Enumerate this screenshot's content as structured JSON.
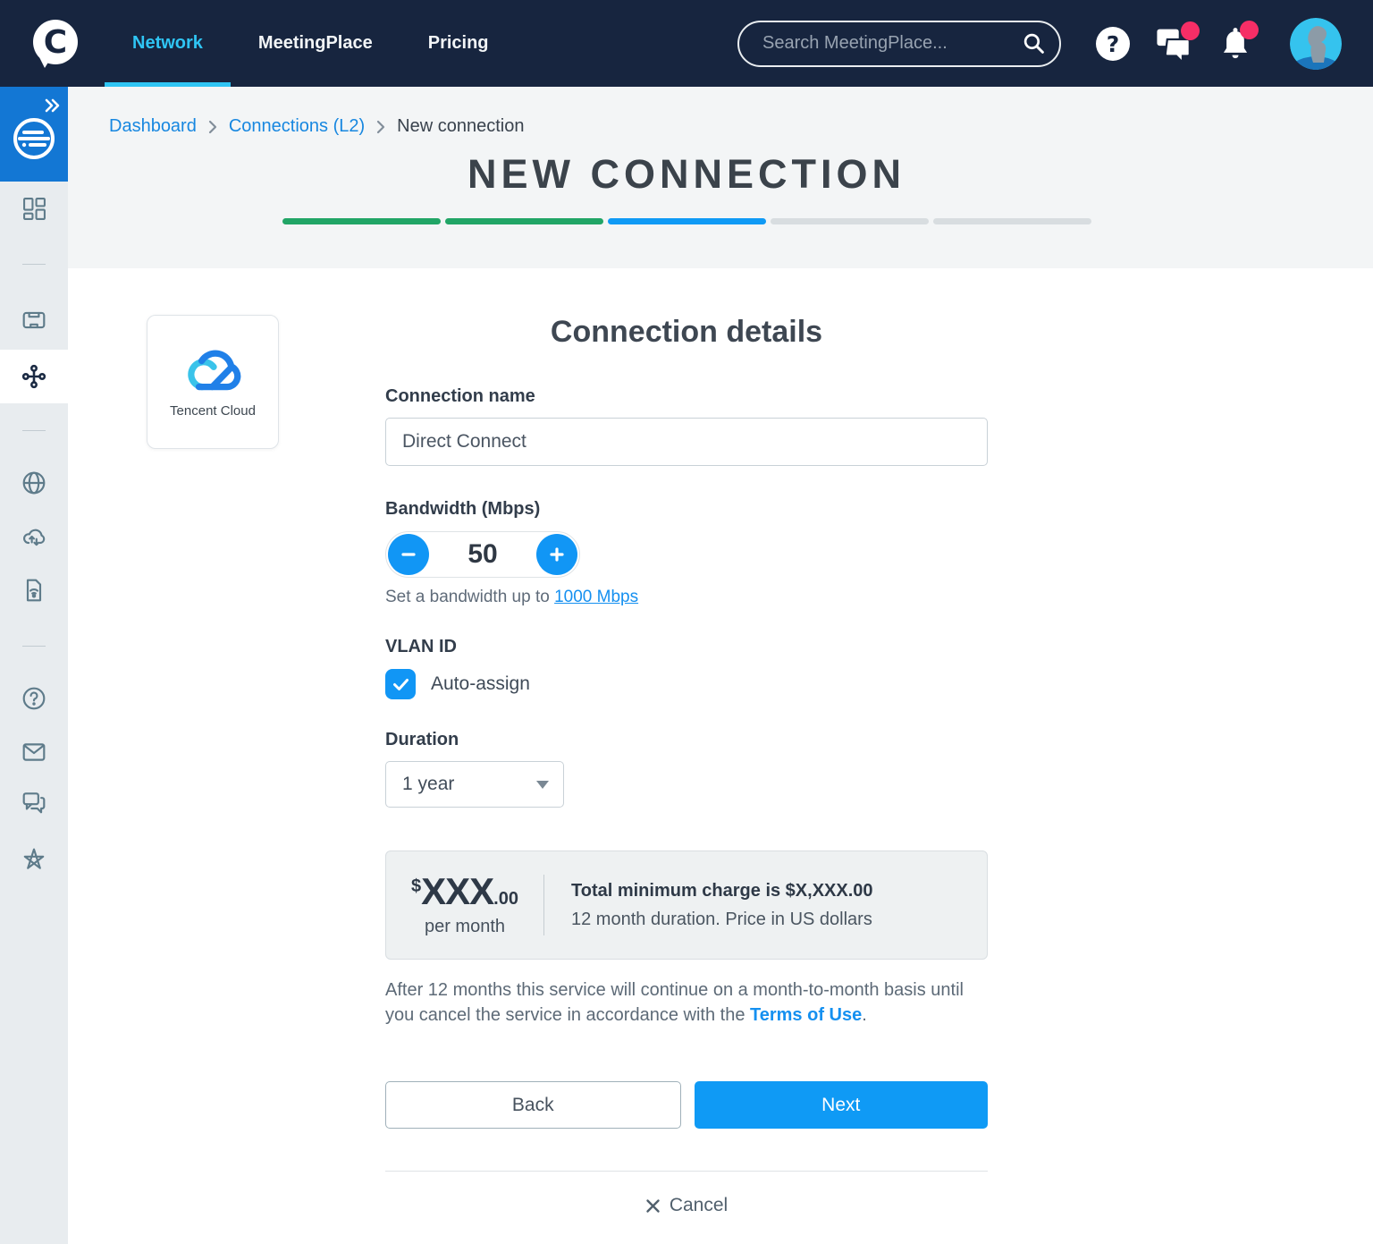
{
  "colors": {
    "navbar_bg": "#17253F",
    "accent_cyan": "#2FC5F4",
    "accent_blue": "#0F9AF5",
    "link_blue": "#1787E0",
    "progress_green": "#21A566",
    "badge_pink": "#F62E66",
    "sidebar_blue": "#1377D4"
  },
  "navbar": {
    "tabs": [
      {
        "label": "Network",
        "active": true
      },
      {
        "label": "MeetingPlace",
        "active": false
      },
      {
        "label": "Pricing",
        "active": false
      }
    ],
    "search": {
      "placeholder": "Search MeetingPlace..."
    }
  },
  "breadcrumb": {
    "links": [
      "Dashboard",
      "Connections (L2)"
    ],
    "current": "New connection"
  },
  "page": {
    "title": "NEW CONNECTION"
  },
  "progress": {
    "steps": [
      "done",
      "done",
      "current",
      "todo",
      "todo"
    ]
  },
  "provider": {
    "name": "Tencent Cloud"
  },
  "form": {
    "heading": "Connection details",
    "connection_name": {
      "label": "Connection name",
      "value": "Direct Connect"
    },
    "bandwidth": {
      "label": "Bandwidth (Mbps)",
      "value": "50",
      "helper_text": "Set a bandwidth up to ",
      "helper_link": "1000 Mbps"
    },
    "vlan": {
      "label": "VLAN ID",
      "option": "Auto-assign",
      "checked": true
    },
    "duration": {
      "label": "Duration",
      "selected": "1 year"
    }
  },
  "pricing": {
    "currency": "$",
    "amount": "XXX",
    "cents": ".00",
    "per": "per month",
    "total": "Total minimum charge is $X,XXX.00",
    "note": "12 month duration. Price in US dollars"
  },
  "disclaimer": {
    "before": "After 12 months this service will continue on a month-to-month basis until you cancel the service in accordance with the ",
    "link": "Terms of Use",
    "after": "."
  },
  "actions": {
    "back": "Back",
    "next": "Next",
    "cancel": "Cancel"
  }
}
